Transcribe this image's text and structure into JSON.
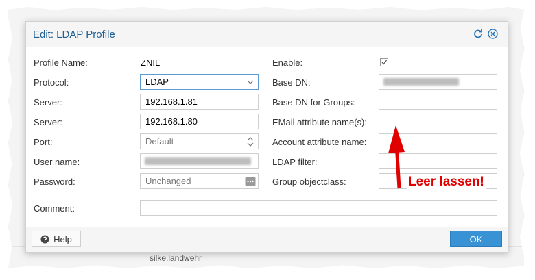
{
  "dialog": {
    "title": "Edit: LDAP Profile",
    "reset_icon": "reset-icon",
    "close_icon": "close-icon"
  },
  "left": {
    "profile_name_label": "Profile Name:",
    "profile_name_value": "ZNIL",
    "protocol_label": "Protocol:",
    "protocol_value": "LDAP",
    "server1_label": "Server:",
    "server1_value": "192.168.1.81",
    "server2_label": "Server:",
    "server2_value": "192.168.1.80",
    "port_label": "Port:",
    "port_placeholder": "Default",
    "username_label": "User name:",
    "password_label": "Password:",
    "password_placeholder": "Unchanged"
  },
  "right": {
    "enable_label": "Enable:",
    "enable_checked": true,
    "base_dn_label": "Base DN:",
    "base_dn_groups_label": "Base DN for Groups:",
    "email_attr_label": "EMail attribute name(s):",
    "account_attr_label": "Account attribute name:",
    "ldap_filter_label": "LDAP filter:",
    "group_objectclass_label": "Group objectclass:"
  },
  "comment_label": "Comment:",
  "footer": {
    "help_label": "Help",
    "ok_label": "OK"
  },
  "background": {
    "user_text": "silke.landwehr"
  },
  "annotation": {
    "text": "Leer lassen!",
    "color": "#e10000"
  },
  "colors": {
    "title": "#1f5f93",
    "ok_button": "#3892d4"
  }
}
